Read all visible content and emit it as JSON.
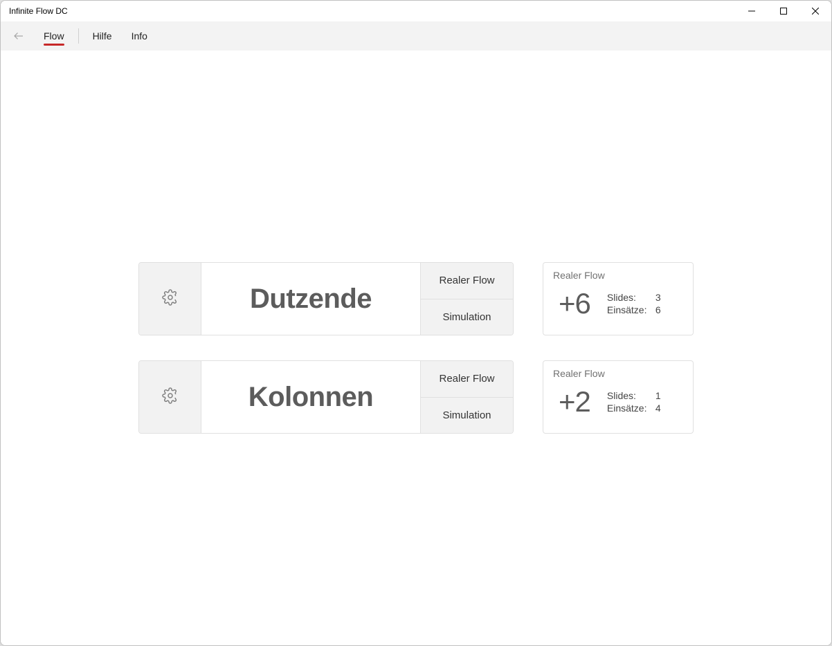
{
  "window": {
    "title": "Infinite Flow DC"
  },
  "menu": {
    "items": [
      "Flow",
      "Hilfe",
      "Info"
    ],
    "active_index": 0
  },
  "rows": [
    {
      "label": "Dutzende",
      "actions": [
        "Realer Flow",
        "Simulation"
      ],
      "card": {
        "title": "Realer Flow",
        "value": "+6",
        "stats": [
          {
            "label": "Slides:",
            "value": "3"
          },
          {
            "label": "Einsätze:",
            "value": "6"
          }
        ]
      }
    },
    {
      "label": "Kolonnen",
      "actions": [
        "Realer Flow",
        "Simulation"
      ],
      "card": {
        "title": "Realer Flow",
        "value": "+2",
        "stats": [
          {
            "label": "Slides:",
            "value": "1"
          },
          {
            "label": "Einsätze:",
            "value": "4"
          }
        ]
      }
    }
  ]
}
